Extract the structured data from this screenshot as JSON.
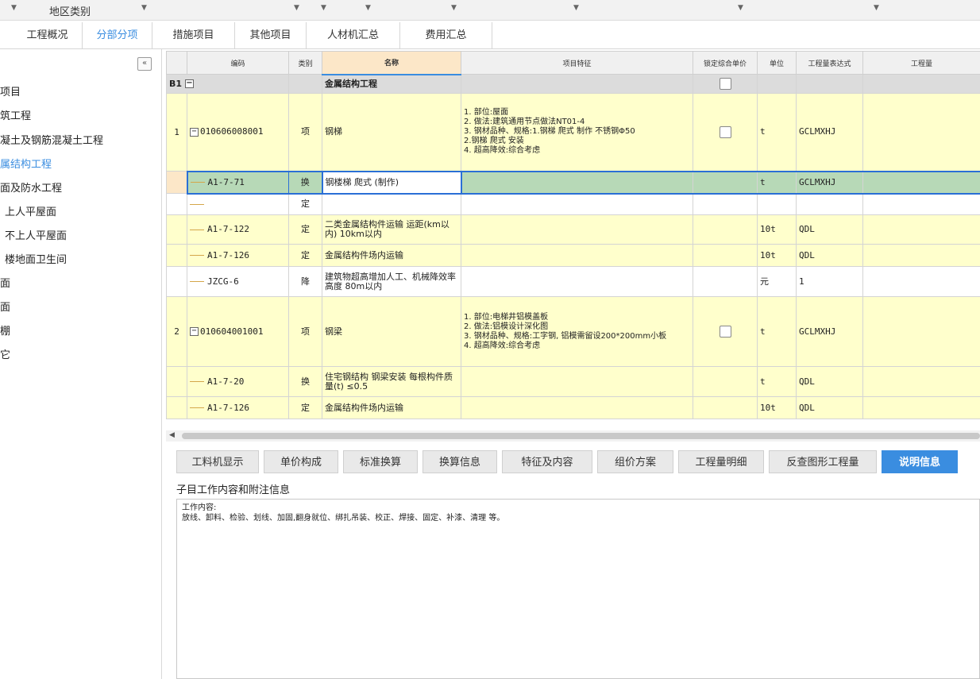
{
  "filterbar": {
    "label": "地区类别"
  },
  "main_tabs": [
    "工程概况",
    "分部分项",
    "措施项目",
    "其他项目",
    "人材机汇总",
    "费用汇总"
  ],
  "sidebar": {
    "collapse_icon": "«",
    "items": [
      "项目",
      "筑工程",
      "凝土及钢筋混凝土工程",
      "属结构工程",
      "面及防水工程",
      "上人平屋面",
      "不上人平屋面",
      "楼地面卫生间",
      "面",
      "面",
      "棚",
      "它"
    ]
  },
  "grid": {
    "headers": [
      "编码",
      "类别",
      "名称",
      "项目特征",
      "锁定综合单价",
      "单位",
      "工程量表达式",
      "工程量"
    ],
    "section": {
      "code": "B1",
      "expand": "−",
      "name": "金属结构工程"
    },
    "rows": [
      {
        "num": "1",
        "expand": "−",
        "code": "010606008001",
        "type": "项",
        "name": "钢梯",
        "features": "1. 部位:屋面\n2. 做法:建筑通用节点做法NT01-4\n3. 钢材品种、规格:1.钢梯 爬式 制作 不锈钢Φ50\n2.钢梯 爬式 安装\n4. 超高降效:综合考虑",
        "unit": "t",
        "expr": "GCLMXHJ"
      },
      {
        "code": "A1-7-71",
        "type": "换",
        "name": "钢楼梯 爬式 (制作)",
        "unit": "t",
        "expr": "GCLMXHJ"
      },
      {
        "code": "",
        "type": "定",
        "name": "",
        "unit": "",
        "expr": ""
      },
      {
        "code": "A1-7-122",
        "type": "定",
        "name": "二类金属结构件运输 运距(km以内) 10km以内",
        "unit": "10t",
        "expr": "QDL"
      },
      {
        "code": "A1-7-126",
        "type": "定",
        "name": "金属结构件场内运输",
        "unit": "10t",
        "expr": "QDL"
      },
      {
        "code": "JZCG-6",
        "type": "降",
        "name": "建筑物超高增加人工、机械降效率 高度 80m以内",
        "unit": "元",
        "expr": "1"
      },
      {
        "num": "2",
        "expand": "−",
        "code": "010604001001",
        "type": "项",
        "name": "钢梁",
        "features": "1. 部位:电梯井铝模盖板\n2. 做法:铝模设计深化图\n3. 钢材品种、规格:工字钢, 铝模需留设200*200mm小板\n4. 超高降效:综合考虑",
        "unit": "t",
        "expr": "GCLMXHJ"
      },
      {
        "code": "A1-7-20",
        "type": "换",
        "name": "住宅钢结构 钢梁安装 每根构件质量(t) ≤0.5",
        "unit": "t",
        "expr": "QDL"
      },
      {
        "code": "A1-7-126",
        "type": "定",
        "name": "金属结构件场内运输",
        "unit": "10t",
        "expr": "QDL"
      }
    ]
  },
  "scroll_left_icon": "◀",
  "bottom_tabs": [
    "工料机显示",
    "单价构成",
    "标准换算",
    "换算信息",
    "特征及内容",
    "组价方案",
    "工程量明细",
    "反查图形工程量",
    "说明信息"
  ],
  "info": {
    "title": "子目工作内容和附注信息",
    "label": "工作内容:",
    "content": "放线、卸料、检验、划线、加固,翻身就位、绑扎吊装、校正、焊接、固定、补漆、清理 等。"
  }
}
